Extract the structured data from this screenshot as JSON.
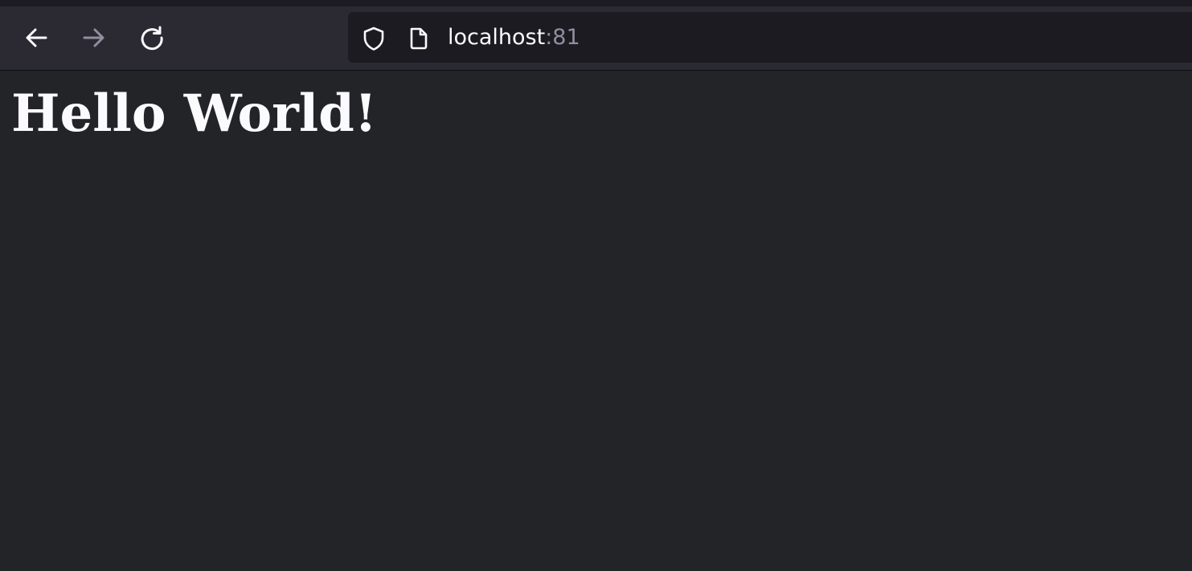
{
  "browser": {
    "url_host": "localhost",
    "url_port": ":81",
    "icons": {
      "back": "arrow-left-icon",
      "forward": "arrow-right-icon",
      "reload": "reload-icon",
      "security": "shield-icon",
      "page": "page-icon"
    },
    "colors": {
      "toolbar": "#2b2a33",
      "urlbar": "#1c1b22",
      "content_background": "#232427",
      "text": "#fbfbfe",
      "port_text": "#8f8f9d",
      "disabled_icon": "#8f8f9d"
    },
    "forward_enabled": false
  },
  "page": {
    "heading": "Hello World!"
  }
}
